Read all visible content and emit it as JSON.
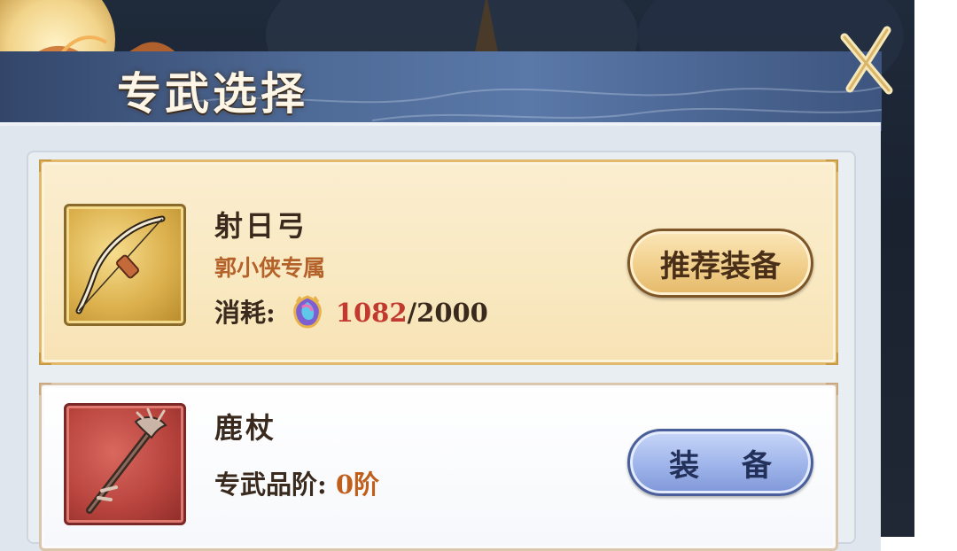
{
  "window": {
    "title": "专武选择"
  },
  "weapons": [
    {
      "name": "射日弓",
      "owner": "郭小侠专属",
      "cost_label": "消耗:",
      "cost_current": "1082",
      "cost_total": "/2000",
      "icon": "bow-icon",
      "button_label": "推荐装备",
      "style": "gold"
    },
    {
      "name": "鹿杖",
      "tier_label": "专武品阶:",
      "tier_value": "0阶",
      "icon": "deer-staff-icon",
      "button_label": "装 备",
      "style": "blue"
    }
  ],
  "icons": {
    "currency": "rainbow-gem-icon",
    "close": "close-x-icon"
  },
  "colors": {
    "cost_highlight": "#c2392f",
    "owner_text": "#b4622a",
    "tier_value": "#c05f1c",
    "banner": "#4e6a96",
    "gold_card": "#f9e9c1"
  }
}
